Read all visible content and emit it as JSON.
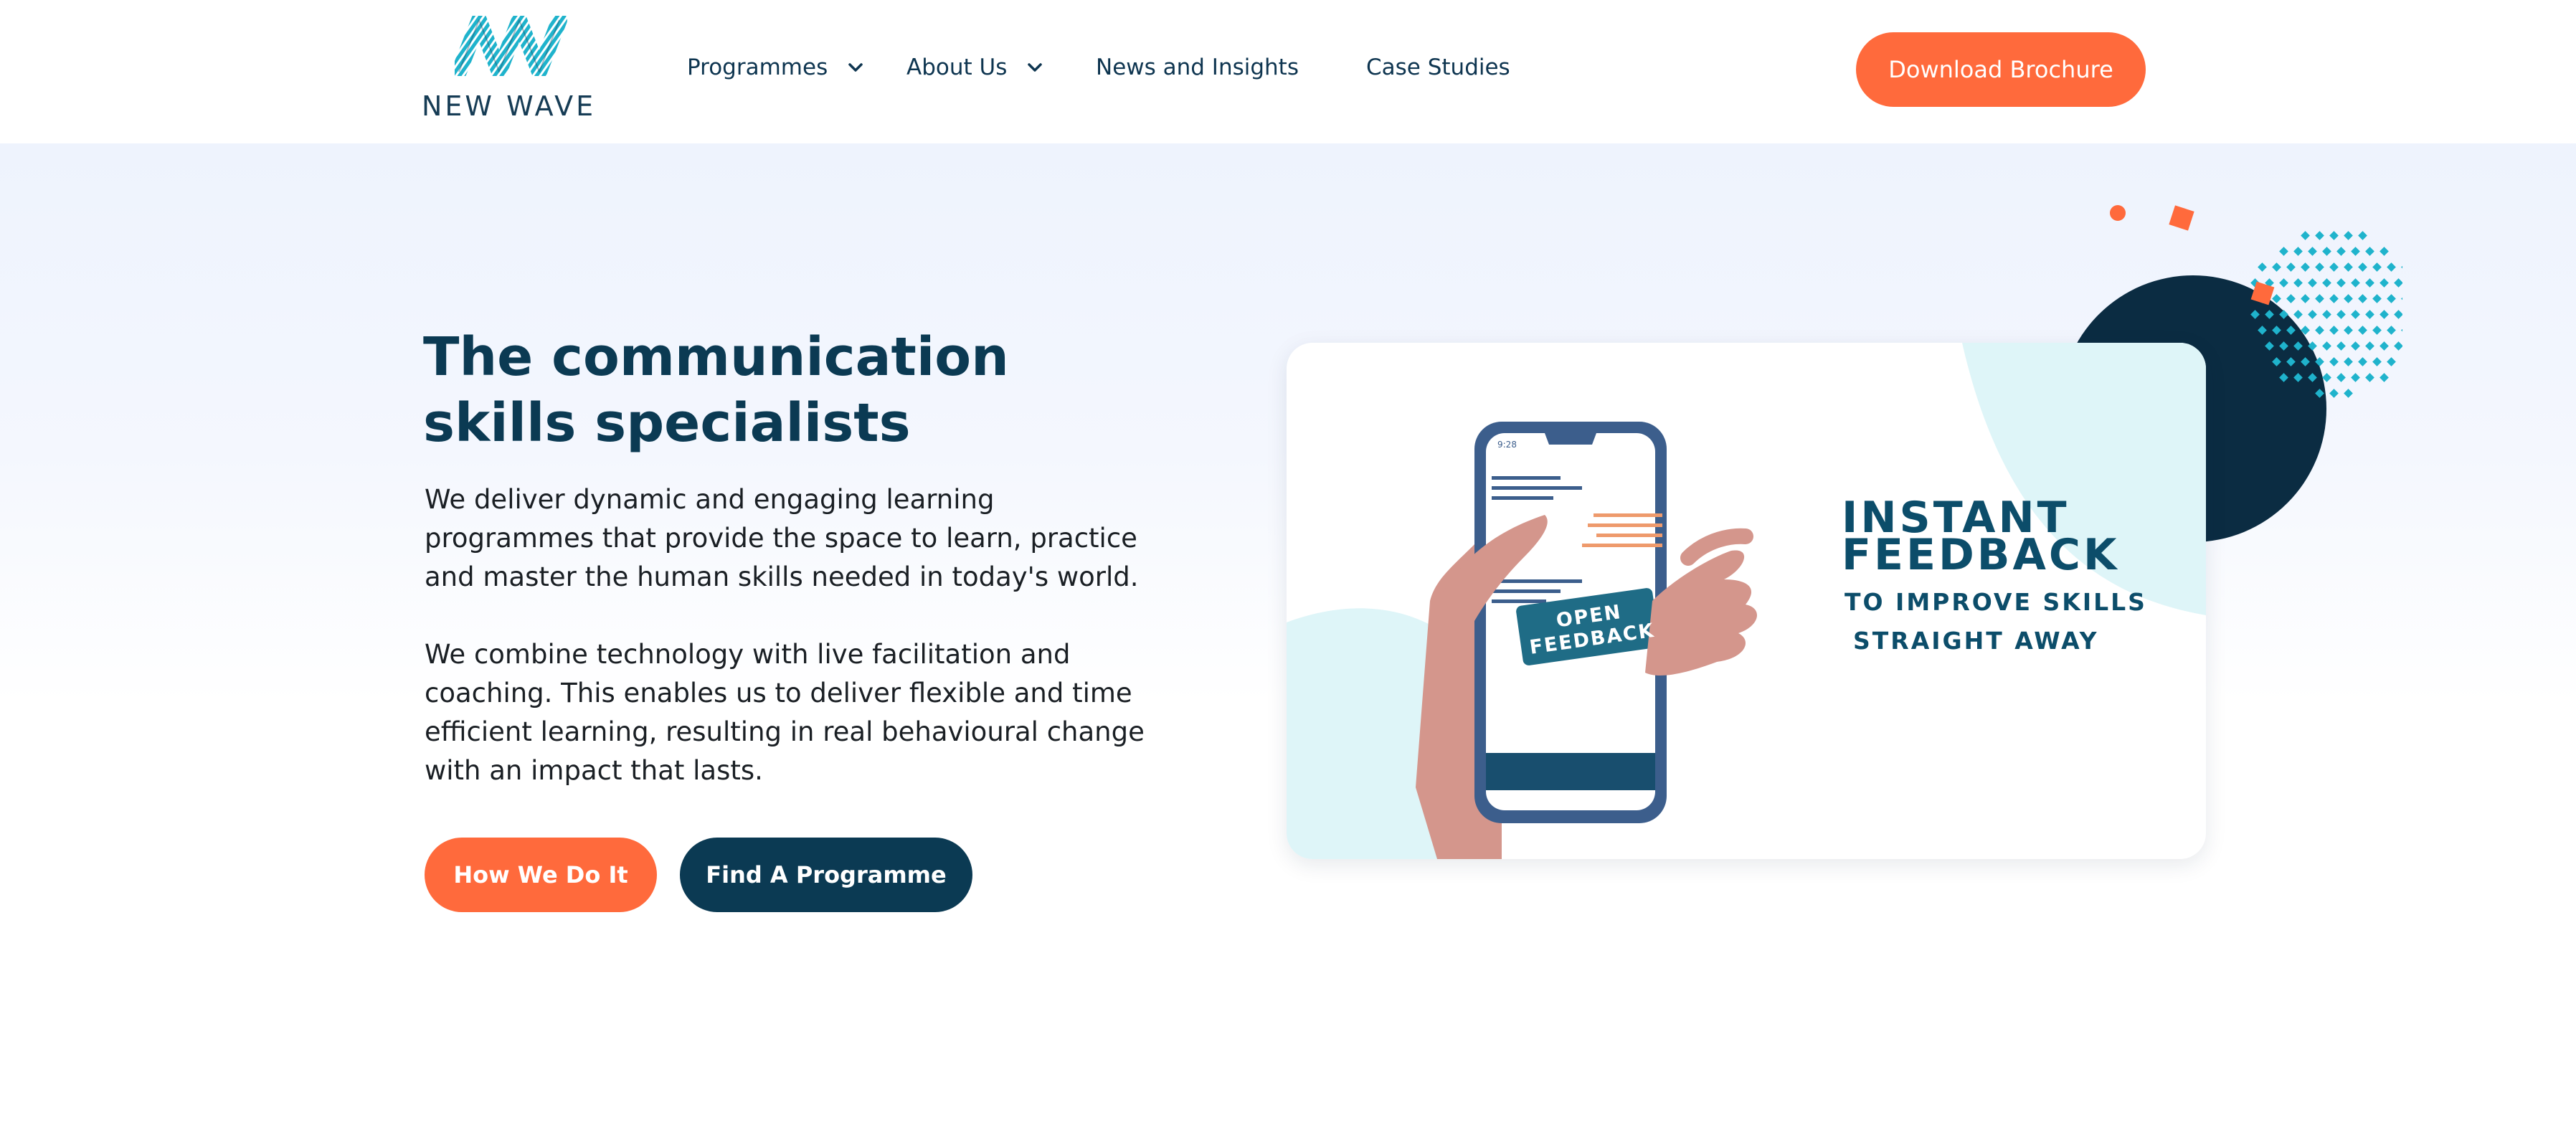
{
  "brand": {
    "logo_text": "NEW WAVE",
    "colors": {
      "navy": "#0b3a53",
      "orange": "#ff6a3c",
      "teal": "#1fb3cc"
    }
  },
  "nav": {
    "items": [
      {
        "label": "Programmes",
        "has_dropdown": true
      },
      {
        "label": "About Us",
        "has_dropdown": true
      },
      {
        "label": "News and Insights",
        "has_dropdown": false
      },
      {
        "label": "Case Studies",
        "has_dropdown": false
      }
    ],
    "cta_label": "Download Brochure"
  },
  "hero": {
    "title": "The communication skills specialists",
    "paragraph_1": "We deliver dynamic and engaging learning programmes that provide the space to learn, practice and master the human skills needed in today's world.",
    "paragraph_2": "We combine technology with live facilitation and coaching. This enables us to deliver flexible and time efficient learning, resulting in real behavioural change with an impact that lasts.",
    "buttons": {
      "primary": "How We Do It",
      "secondary": "Find A Programme"
    }
  },
  "card": {
    "line_1": "INSTANT",
    "line_2": "FEEDBACK",
    "line_3": "TO IMPROVE SKILLS",
    "line_4": "STRAIGHT AWAY",
    "button_text": "OPEN FEEDBACK",
    "phone_time": "9:28"
  },
  "icons": [
    "new-wave-logo-icon",
    "chevron-down-icon",
    "phone-illustration-icon"
  ]
}
